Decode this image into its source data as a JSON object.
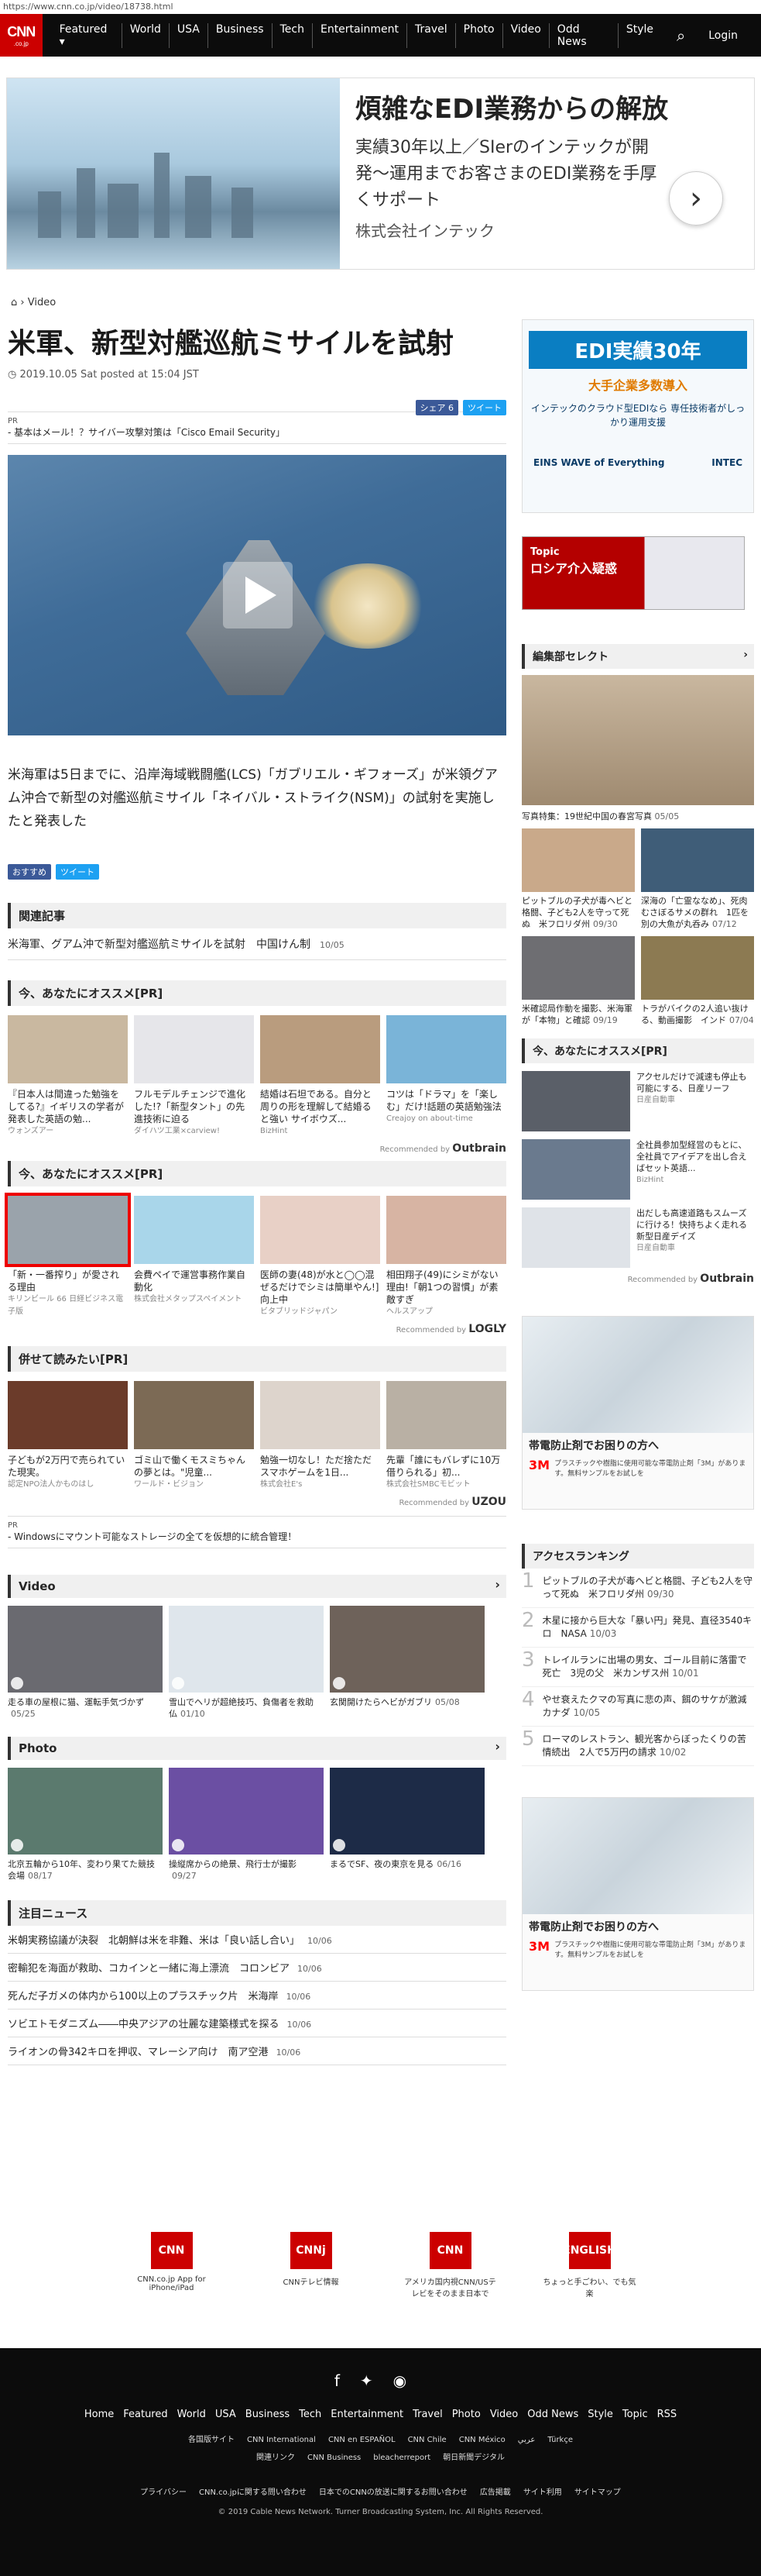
{
  "url": "https://www.cnn.co.jp/video/18738.html",
  "nav": {
    "logo": "CNN",
    "logo_sub": ".co.jp",
    "items": [
      "Featured ▾",
      "World",
      "USA",
      "Business",
      "Tech",
      "Entertainment",
      "Travel",
      "Photo",
      "Video",
      "Odd News",
      "Style"
    ],
    "login": "Login"
  },
  "ad_top": {
    "headline": "煩雑なEDI業務からの解放",
    "body": "実績30年以上／SIerのインテックが開発〜運用までお客さまのEDI業務を手厚くサポート",
    "company": "株式会社インテック"
  },
  "breadcrumb": "Video",
  "article": {
    "title": "米軍、新型対艦巡航ミサイルを試射",
    "date": "2019.10.05 Sat posted at 15:04 JST",
    "share_fb": "シェア 6",
    "share_tw": "ツイート",
    "pr_label": "PR",
    "pr_text": "- 基本はメール！？サイバー攻撃対策は「Cisco Email Security」",
    "body": "米海軍は5日までに、沿岸海域戦闘艦(LCS)「ガブリエル・ギフォーズ」が米領グアム沖合で新型の対艦巡航ミサイル「ネイバル・ストライク(NSM)」の試射を実施したと発表した",
    "share2_fb": "おすすめ",
    "share2_tw": "ツイート"
  },
  "related": {
    "title": "関連記事",
    "item": "米海軍、グアム沖で新型対艦巡航ミサイルを試射",
    "source": "中国けん制",
    "date": "10/05"
  },
  "reco1": {
    "title": "今、あなたにオススメ[PR]",
    "cards": [
      {
        "text": "『日本人は間違った勉強をしてる?』イギリスの学者が発表した英語の勉...",
        "src": "ウォンズアー",
        "c": "#c9b8a0"
      },
      {
        "text": "フルモデルチェンジで進化した!?「新型タント」の先進技術に迫る",
        "src": "ダイハツ工業×carview!",
        "c": "#e6e6ea"
      },
      {
        "text": "結婚は石坦である。自分と周りの形を理解して結婚ると強い サイボウズ...",
        "src": "BizHint",
        "c": "#b99c7e"
      },
      {
        "text": "コツは「ドラマ」を「楽しむ」だけ!話題の英語勉強法",
        "src": "Creajoy on about-time",
        "c": "#7ab4d8"
      }
    ],
    "recby": "Recommended by",
    "brand": "Outbrain"
  },
  "reco2": {
    "title": "今、あなたにオススメ[PR]",
    "cards": [
      {
        "text": "「新・一番搾り」が愛される理由",
        "src": "キリンビール 66 日経ビジネス電子版",
        "c": "#9aa3ab"
      },
      {
        "text": "会費ペイで運営事務作業自動化",
        "src": "株式会社メタップスペイメント",
        "c": "#a9d6ea"
      },
      {
        "text": "医師の妻(48)が水と◯◯混ぜるだけでシミは簡単やん!]向上中",
        "src": "ビタブリッドジャパン",
        "c": "#e8d0c6"
      },
      {
        "text": "相田翔子(49)にシミがない理由!「朝1つの習慣」が素敵すぎ",
        "src": "ヘルスアップ",
        "c": "#d7b4a3"
      }
    ],
    "recby": "Recommended by",
    "brand": "LOGLY"
  },
  "reco3": {
    "title": "併せて読みたい[PR]",
    "cards": [
      {
        "text": "子どもが2万円で売られていた現実。",
        "src": "認定NPO法人かものはし",
        "c": "#6b3b2a"
      },
      {
        "text": "ゴミ山で働くモスミちゃんの夢とは。\"児童...",
        "src": "ワールド・ビジョン",
        "c": "#7c6a55"
      },
      {
        "text": "勉強一切なし！ただ捨ただスマホゲームを1日...",
        "src": "株式会社E's",
        "c": "#ddd4cc"
      },
      {
        "text": "先輩「誰にもバレずに10万借りられる」初...",
        "src": "株式会社SMBCモビット",
        "c": "#b9b0a4"
      }
    ],
    "recby": "Recommended by",
    "brand": "UZOU"
  },
  "pr2": {
    "label": "PR",
    "text": "- Windowsにマウント可能なストレージの全てを仮想的に統合管理！"
  },
  "video": {
    "title": "Video",
    "cards": [
      {
        "text": "走る車の屋根に猫、運転手気づかず",
        "date": "05/25",
        "c": "#6a6a70"
      },
      {
        "text": "雪山でヘリが超絶技巧、負傷者を救助　仏",
        "date": "01/10",
        "c": "#dfe6ec"
      },
      {
        "text": "玄関開けたらヘビがガブリ",
        "date": "05/08",
        "c": "#6e625a"
      }
    ]
  },
  "photo": {
    "title": "Photo",
    "cards": [
      {
        "text": "北京五輪から10年、変わり果てた競技会場",
        "date": "08/17",
        "c": "#5b7a6e"
      },
      {
        "text": "操縦席からの絶景、飛行士が撮影",
        "date": "09/27",
        "c": "#6b4fa3"
      },
      {
        "text": "まるでSF、夜の東京を見る",
        "date": "06/16",
        "c": "#1d2b47"
      }
    ]
  },
  "news": {
    "title": "注目ニュース",
    "items": [
      {
        "text": "米朝実務協議が決裂　北朝鮮は米を非難、米は「良い話し合い」",
        "date": "10/06"
      },
      {
        "text": "密輸犯を海面が救助、コカインと一緒に海上漂流　コロンビア",
        "date": "10/06"
      },
      {
        "text": "死んだ子ガメの体内から100以上のプラスチック片　米海岸",
        "date": "10/06"
      },
      {
        "text": "ソビエトモダニズム――中央アジアの壮麗な建築様式を探る",
        "date": "10/06"
      },
      {
        "text": "ライオンの骨342キロを押収、マレーシア向け　南ア空港",
        "date": "10/06"
      }
    ]
  },
  "side": {
    "ad1": {
      "headline": "EDI実績30年",
      "sub": "大手企業多数導入",
      "body": "インテックのクラウド型EDIなら 専任技術者がしっかり運用支援",
      "brand": "EINS WAVE of Everything",
      "brand2": "INTEC"
    },
    "topic": {
      "label": "Topic",
      "text": "ロシア介入疑惑"
    },
    "editor": {
      "title": "編集部セレクト",
      "main": "写真特集：19世紀中国の春宮写真",
      "main_date": "05/05",
      "items": [
        {
          "text": "ピットブルの子犬が毒ヘビと格闘、子ども2人を守って死ぬ　米フロリダ州",
          "date": "09/30",
          "c": "#c9a98a"
        },
        {
          "text": "深海の「亡霊ななめ」、死肉むさぼるサメの群れ　1匹を別の大魚が丸呑み",
          "date": "07/12",
          "c": "#3f5d78"
        },
        {
          "text": "米確認局作動を撮影、米海軍が「本物」と確認",
          "date": "09/19",
          "c": "#6e6e72"
        },
        {
          "text": "トラがバイクの2人追い抜ける、動画撮影　インド",
          "date": "07/04",
          "c": "#8c7a52"
        }
      ]
    },
    "reco": {
      "title": "今、あなたにオススメ[PR]",
      "items": [
        {
          "text": "アクセルだけで減速も停止も可能にする、日産リーフ",
          "src": "日産自動車",
          "c": "#5a5f68"
        },
        {
          "text": "全社員参加型経営のもとに、全社員でアイデアを出し合えばセット英語...",
          "src": "BizHint",
          "c": "#6a7a8e"
        },
        {
          "text": "出だしも高速道路もスムーズに行ける！快持ちよく走れる新型日産デイズ",
          "src": "日産自動車",
          "c": "#dfe3e8"
        }
      ],
      "recby": "Recommended by",
      "brand": "Outbrain"
    },
    "ad2": {
      "headline": "帯電防止剤でお困りの方へ",
      "body": "プラスチックや樹脂に使用可能な帯電防止剤「3M」があります。無料サンプルをお試しを",
      "brand": "3M"
    },
    "ranking": {
      "title": "アクセスランキング",
      "items": [
        {
          "text": "ピットブルの子犬が毒ヘビと格闘、子ども2人を守って死ぬ　米フロリダ州",
          "date": "09/30"
        },
        {
          "text": "木星に接から巨大な「暴い円」発見、直径3540キロ　NASA",
          "date": "10/03"
        },
        {
          "text": "トレイルランに出場の男女、ゴール目前に落雷で死亡　3児の父　米カンザス州",
          "date": "10/01"
        },
        {
          "text": "やせ衰えたクマの写真に悲の声、餌のサケが激減　カナダ",
          "date": "10/05"
        },
        {
          "text": "ローマのレストラン、観光客からぼったくりの苦情続出　2人で5万円の請求",
          "date": "10/02"
        }
      ]
    },
    "ad3": {
      "headline": "帯電防止剤でお困りの方へ",
      "body": "プラスチックや樹脂に使用可能な帯電防止剤「3M」があります。無料サンプルをお試しを",
      "brand": "3M"
    }
  },
  "apps": [
    {
      "label": "CNN.co.jp App for iPhone/iPad",
      "logo": "CNN"
    },
    {
      "label": "CNNテレビ情報",
      "logo": "CNNj"
    },
    {
      "label": "アメリカ国内視CNN/USテレビをそのまま日本で",
      "logo": "CNN"
    },
    {
      "label": "ちょっと手ごわい、でも気楽",
      "logo": "ENGLISH"
    }
  ],
  "footer": {
    "links": [
      "Home",
      "Featured",
      "World",
      "USA",
      "Business",
      "Tech",
      "Entertainment",
      "Travel",
      "Photo",
      "Video",
      "Odd News",
      "Style",
      "Topic",
      "RSS"
    ],
    "intl": [
      "各国版サイト",
      "CNN International",
      "CNN en ESPAÑOL",
      "CNN Chile",
      "CNN México",
      "عربي",
      "Türkçe"
    ],
    "rel": [
      "関連リンク",
      "CNN Business",
      "bleacherreport",
      "朝日新聞デジタル"
    ],
    "policy": [
      "プライバシー",
      "CNN.co.jpに関する問い合わせ",
      "日本でのCNNの放送に関するお問い合わせ",
      "広告掲載",
      "サイト利用",
      "サイトマップ"
    ],
    "copyright": "© 2019 Cable News Network.  Turner Broadcasting System, Inc.  All Rights Reserved."
  }
}
